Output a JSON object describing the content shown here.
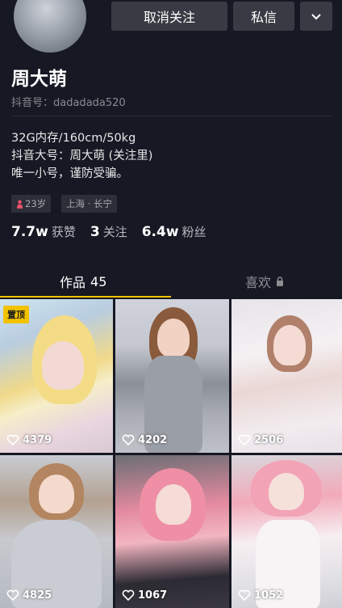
{
  "header": {
    "unfollow_label": "取消关注",
    "message_label": "私信"
  },
  "profile": {
    "name": "周大萌",
    "douyin_id": "抖音号：dadadada520",
    "bio": [
      "32G内存/160cm/50kg",
      "抖音大号：周大萌 (关注里)",
      "唯一小号，谨防受骗。"
    ],
    "age_tag": "23岁",
    "location_tag": "上海 · 长宁"
  },
  "stats": {
    "likes_num": "7.7w",
    "likes_label": "获赞",
    "following_num": "3",
    "following_label": "关注",
    "followers_num": "6.4w",
    "followers_label": "粉丝"
  },
  "tabs": {
    "works_label": "作品",
    "works_count": "45",
    "likes_label": "喜欢"
  },
  "videos": [
    {
      "likes": "4379",
      "pinned_label": "置顶"
    },
    {
      "likes": "4202"
    },
    {
      "likes": "2506"
    },
    {
      "likes": "4825"
    },
    {
      "likes": "1067"
    },
    {
      "likes": "1052"
    }
  ],
  "colors": {
    "background": "#161823",
    "accent": "#f2c200",
    "button": "#393b44"
  }
}
